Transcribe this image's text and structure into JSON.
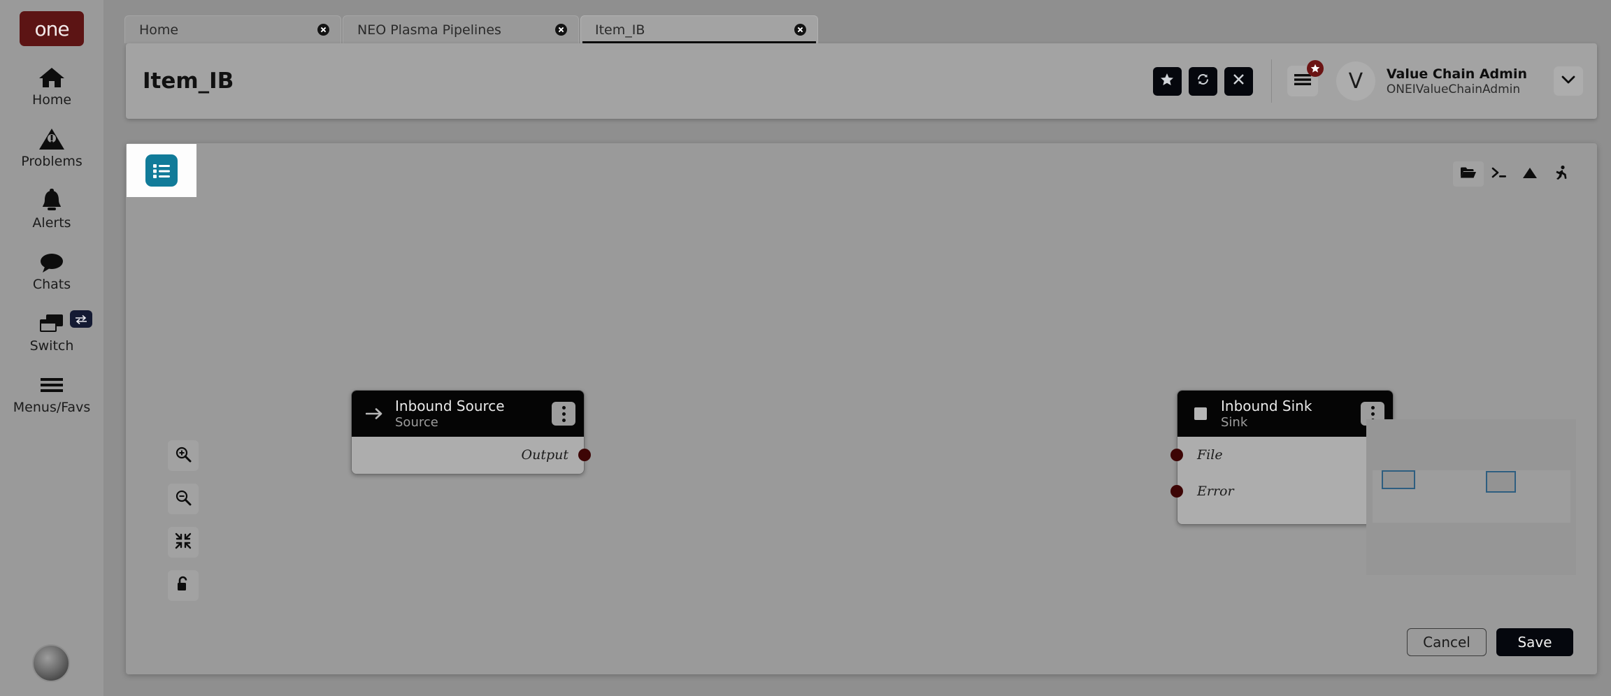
{
  "sidebar": {
    "brand": "one",
    "items": [
      {
        "label": "Home",
        "icon": "home-icon"
      },
      {
        "label": "Problems",
        "icon": "warning-triangle-icon"
      },
      {
        "label": "Alerts",
        "icon": "bell-icon"
      },
      {
        "label": "Chats",
        "icon": "chat-bubble-icon"
      },
      {
        "label": "Switch",
        "icon": "windows-stack-icon",
        "badge_icon": "swap-arrows-icon"
      },
      {
        "label": "Menus/Favs",
        "icon": "hamburger-icon"
      }
    ],
    "avatar_icon": "user-photo-avatar"
  },
  "tabs": [
    {
      "label": "Home",
      "active": false,
      "close_icon": "close-circle-icon"
    },
    {
      "label": "NEO Plasma Pipelines",
      "active": false,
      "close_icon": "close-circle-icon"
    },
    {
      "label": "Item_IB",
      "active": true,
      "close_icon": "close-circle-icon"
    }
  ],
  "header": {
    "title": "Item_IB",
    "actions": [
      {
        "name": "favorite-button",
        "icon": "star-icon"
      },
      {
        "name": "refresh-button",
        "icon": "refresh-icon"
      },
      {
        "name": "close-button",
        "icon": "x-icon"
      }
    ],
    "menu_icon": "hamburger-icon",
    "menu_badge_icon": "star-icon",
    "user": {
      "avatar_initial": "V",
      "name": "Value Chain Admin",
      "login": "ONEIValueChainAdmin",
      "chevron_icon": "chevron-down-icon"
    }
  },
  "main": {
    "panel_tab_icon": "list-view-icon",
    "canvas_toolbar": [
      {
        "name": "open-folder-button",
        "icon": "folder-open-icon",
        "selected": true
      },
      {
        "name": "console-button",
        "icon": "terminal-icon",
        "selected": false
      },
      {
        "name": "image-button",
        "icon": "mountain-image-icon",
        "selected": false
      },
      {
        "name": "run-button",
        "icon": "running-person-icon",
        "selected": false
      }
    ],
    "canvas_left_tools": [
      {
        "name": "zoom-in-button",
        "icon": "magnifier-plus-icon"
      },
      {
        "name": "zoom-out-button",
        "icon": "magnifier-minus-icon"
      },
      {
        "name": "fit-to-screen-button",
        "icon": "collapse-arrows-icon"
      },
      {
        "name": "lock-toggle-button",
        "icon": "unlock-icon"
      }
    ],
    "nodes": [
      {
        "id": "source",
        "title": "Inbound Source",
        "subtitle": "Source",
        "head_icon": "arrow-right-icon",
        "kebab_icon": "more-vertical-icon",
        "ports_out": [
          "Output"
        ],
        "ports_in": []
      },
      {
        "id": "sink",
        "title": "Inbound Sink",
        "subtitle": "Sink",
        "head_icon": "square-icon",
        "kebab_icon": "more-vertical-icon",
        "ports_out": [],
        "ports_in": [
          "File",
          "Error"
        ]
      }
    ],
    "minimap": {
      "node_count": 2
    },
    "footer": {
      "cancel_label": "Cancel",
      "save_label": "Save"
    }
  },
  "colors": {
    "brand_maroon": "#5c1414",
    "accent_teal": "#117b99",
    "port_dark_red": "#3d0505",
    "node_header_black": "#050505",
    "minimap_node_border": "#2e5e80",
    "switch_badge_navy": "#141a33"
  }
}
